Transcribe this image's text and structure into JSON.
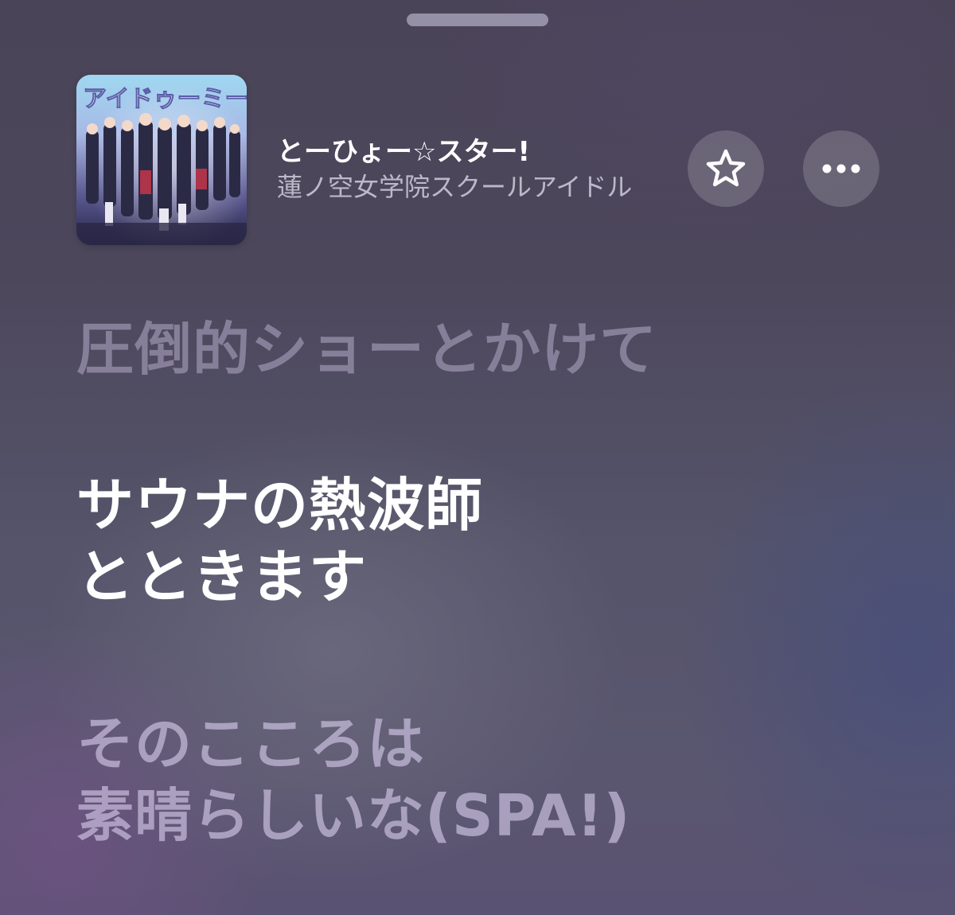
{
  "now_playing": {
    "title": "とーひょー☆スター!",
    "artist": "蓮ノ空女学院スクールアイドル",
    "cover_text": "アイドゥーミー!",
    "favorite_icon": "star-outline-icon",
    "more_icon": "ellipsis-icon"
  },
  "lyrics": {
    "previous_line": "圧倒的ショーとかけて",
    "current_line": [
      "サウナの熱波師",
      "とときます"
    ],
    "next_line": [
      "そのこころは",
      "素晴らしいな(SPA!)"
    ]
  },
  "colors": {
    "background": "#4d475c",
    "active_lyric": "#ffffff",
    "inactive_lyric": "#b4acc8"
  }
}
